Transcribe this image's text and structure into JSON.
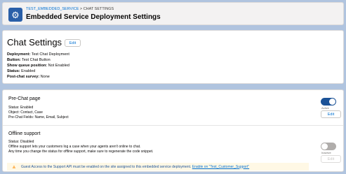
{
  "header": {
    "breadcrumb_parent": "TEST_EMBEDDED_SERVICE",
    "breadcrumb_separator": " > ",
    "breadcrumb_current": "CHAT SETTINGS",
    "title": "Embedded Service Deployment Settings",
    "icon": "gear-icon"
  },
  "chat_settings": {
    "title": "Chat Settings",
    "edit_label": "Edit",
    "fields": [
      {
        "label": "Deployment:",
        "value": " Test Chat Deployment"
      },
      {
        "label": "Button:",
        "value": " Test Chat Button"
      },
      {
        "label": "Show queue position:",
        "value": " Not Enabled"
      },
      {
        "label": "Status:",
        "value": " Enabled"
      },
      {
        "label": "Post-chat survey:",
        "value": " None"
      }
    ]
  },
  "pre_chat": {
    "title": "Pre-Chat page",
    "status": "Status: Enabled",
    "object": "Object: Contact, Case",
    "fields": "Pre-Chat Fields: Name, Email, Subject",
    "toggle_label": "Active",
    "toggle_on": true,
    "edit_label": "Edit"
  },
  "offline": {
    "title": "Offline support",
    "status": "Status: Disabled",
    "desc1": "Offline support lets your customers log a case when your agents aren't online to chat.",
    "desc2": "Any time you change the status for offline support, make sure to regenerate the code snippet.",
    "toggle_label": "Inactive",
    "toggle_on": false,
    "edit_label": "Edit"
  },
  "warning": {
    "text": "Guest Access to the Support API must be enabled on the site assigned to this embedded service deployment. ",
    "link": "Enable on \"Test_Customer_Support\"",
    "icon": "warning-icon"
  },
  "colors": {
    "accent": "#1b5297",
    "link": "#0070d2",
    "background": "#b0c4df",
    "warning_bg": "#fff8e5"
  }
}
